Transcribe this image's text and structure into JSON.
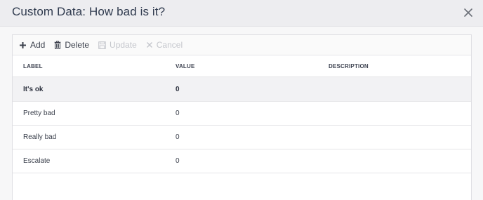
{
  "dialog": {
    "title": "Custom Data: How bad is it?"
  },
  "toolbar": {
    "add_label": "Add",
    "delete_label": "Delete",
    "update_label": "Update",
    "cancel_label": "Cancel"
  },
  "table": {
    "columns": [
      "LABEL",
      "VALUE",
      "DESCRIPTION"
    ],
    "rows": [
      {
        "label": "It's ok",
        "value": "0",
        "description": ""
      },
      {
        "label": "Pretty bad",
        "value": "0",
        "description": ""
      },
      {
        "label": "Really bad",
        "value": "0",
        "description": ""
      },
      {
        "label": "Escalate",
        "value": "0",
        "description": ""
      }
    ]
  },
  "icons": {
    "add": "plus-icon",
    "delete": "trash-icon",
    "update": "save-icon",
    "cancel": "x-icon",
    "close": "close-icon"
  },
  "colors": {
    "header_bg": "#ededf0",
    "title_text": "#2f3a4e",
    "selected_row_bg": "#f2f2f4",
    "disabled_text": "#c4c6cc"
  }
}
